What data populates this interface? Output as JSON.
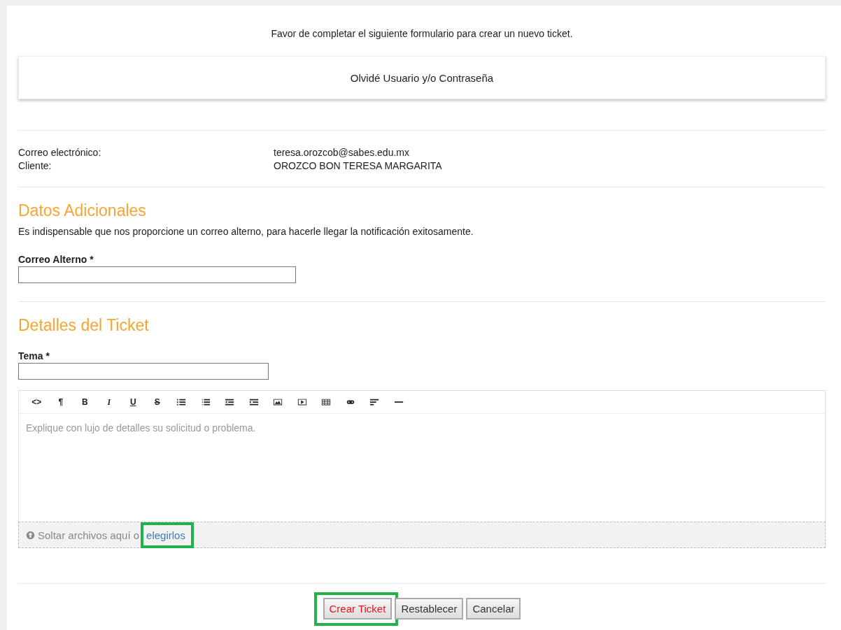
{
  "intro": "Favor de completar el siguiente formulario para crear un nuevo ticket.",
  "forgot_card": "Olvidé Usuario y/o Contraseña",
  "info": [
    {
      "label": "Correo electrónico:",
      "value": "teresa.orozcob@sabes.edu.mx"
    },
    {
      "label": "Cliente:",
      "value": "OROZCO BON TERESA MARGARITA"
    }
  ],
  "additional": {
    "heading": "Datos Adicionales",
    "note": "Es indispensable que nos proporcione un correo alterno, para hacerle llegar la notificación exitosamente.",
    "field_label": "Correo Alterno *"
  },
  "details": {
    "heading": "Detalles del Ticket",
    "field_label": "Tema *"
  },
  "toolbar": [
    {
      "kind": "text",
      "label": "<>"
    },
    {
      "kind": "text",
      "label": "¶"
    },
    {
      "kind": "bold",
      "label": "B"
    },
    {
      "kind": "italic",
      "label": "I"
    },
    {
      "kind": "underline",
      "label": "U"
    },
    {
      "kind": "strike",
      "label": "S"
    },
    {
      "kind": "bullets"
    },
    {
      "kind": "numbers"
    },
    {
      "kind": "outdent"
    },
    {
      "kind": "indent"
    },
    {
      "kind": "image"
    },
    {
      "kind": "video"
    },
    {
      "kind": "table"
    },
    {
      "kind": "link"
    },
    {
      "kind": "align"
    },
    {
      "kind": "rule"
    }
  ],
  "editor": {
    "placeholder": "Explique con lujo de detalles su solicitud o problema."
  },
  "dropzone": {
    "text": "Soltar archivos aquí o",
    "link": "elegirlos",
    "highlighted": true
  },
  "buttons": [
    {
      "label": "Crear Ticket",
      "kind": "primary",
      "highlighted": true
    },
    {
      "label": "Restablecer",
      "kind": "plain",
      "highlighted": false
    },
    {
      "label": "Cancelar",
      "kind": "plain",
      "highlighted": false
    }
  ]
}
